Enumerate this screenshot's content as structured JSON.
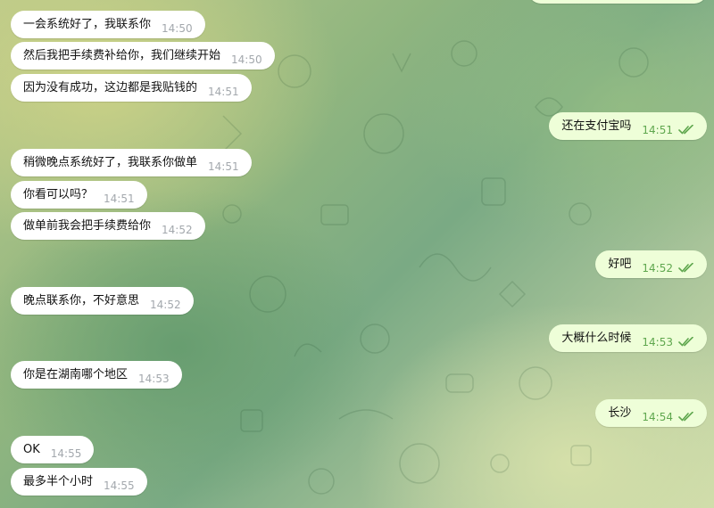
{
  "chat": {
    "incoming": [
      {
        "text": "一会系统好了，我联系你",
        "time": "14:50"
      },
      {
        "text": "然后我把手续费补给你，我们继续开始",
        "time": "14:50"
      },
      {
        "text": "因为没有成功，这边都是我贴钱的",
        "time": "14:51"
      },
      {
        "text": "稍微晚点系统好了，我联系你做单",
        "time": "14:51"
      },
      {
        "text": "你看可以吗？",
        "time": "14:51"
      },
      {
        "text": "做单前我会把手续费给你",
        "time": "14:52"
      },
      {
        "text": "晚点联系你，不好意思",
        "time": "14:52"
      },
      {
        "text": "你是在湖南哪个地区",
        "time": "14:53"
      },
      {
        "text": "OK",
        "time": "14:55"
      },
      {
        "text": "最多半个小时",
        "time": "14:55"
      }
    ],
    "outgoing": [
      {
        "text": "还在支付宝吗",
        "time": "14:51",
        "status_icon": "double-check-icon"
      },
      {
        "text": "好吧",
        "time": "14:52",
        "status_icon": "double-check-icon"
      },
      {
        "text": "大概什么时候",
        "time": "14:53",
        "status_icon": "double-check-icon"
      },
      {
        "text": "长沙",
        "time": "14:54",
        "status_icon": "double-check-icon"
      }
    ]
  },
  "colors": {
    "incoming_bubble": "#ffffff",
    "outgoing_bubble": "#eefed8",
    "outgoing_time": "#5fa74e",
    "incoming_time": "#a3a8ad"
  }
}
